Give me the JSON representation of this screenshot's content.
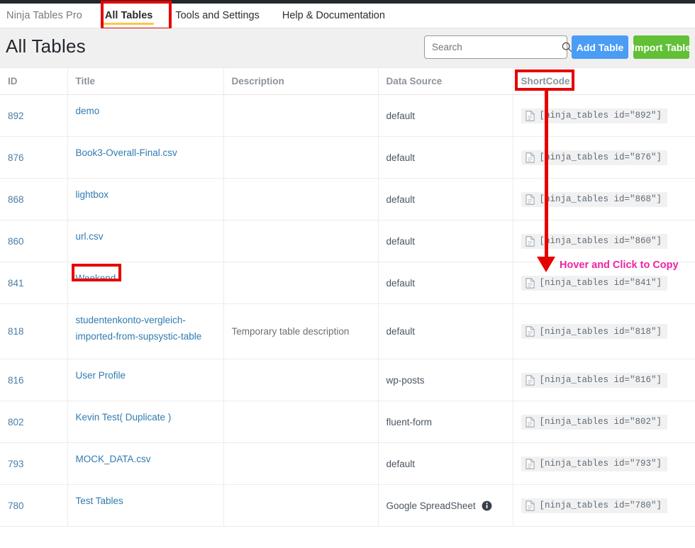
{
  "nav": {
    "brand": "Ninja Tables Pro",
    "tabs": [
      {
        "label": "All Tables",
        "active": true
      },
      {
        "label": "Tools and Settings",
        "active": false
      },
      {
        "label": "Help & Documentation",
        "active": false
      }
    ]
  },
  "header": {
    "title": "All Tables",
    "search_placeholder": "Search",
    "search_value": "",
    "add_table_label": "Add Table",
    "import_table_label": "Import Table"
  },
  "table": {
    "columns": [
      "ID",
      "Title",
      "Description",
      "Data Source",
      "ShortCode"
    ],
    "rows": [
      {
        "id": "892",
        "title": "demo",
        "description": "",
        "source": "default",
        "source_info": false,
        "shortcode": "[ninja_tables id=\"892\"]"
      },
      {
        "id": "876",
        "title": "Book3-Overall-Final.csv",
        "description": "",
        "source": "default",
        "source_info": false,
        "shortcode": "[ninja_tables id=\"876\"]"
      },
      {
        "id": "868",
        "title": "lightbox",
        "description": "",
        "source": "default",
        "source_info": false,
        "shortcode": "[ninja_tables id=\"868\"]"
      },
      {
        "id": "860",
        "title": "url.csv",
        "description": "",
        "source": "default",
        "source_info": false,
        "shortcode": "[ninja_tables id=\"860\"]"
      },
      {
        "id": "841",
        "title": "Weekend",
        "description": "",
        "source": "default",
        "source_info": false,
        "shortcode": "[ninja_tables id=\"841\"]"
      },
      {
        "id": "818",
        "title": "studentenkonto-vergleich-imported-from-supsystic-table",
        "description": "Temporary table description",
        "source": "default",
        "source_info": false,
        "shortcode": "[ninja_tables id=\"818\"]"
      },
      {
        "id": "816",
        "title": "User Profile",
        "description": "",
        "source": "wp-posts",
        "source_info": false,
        "shortcode": "[ninja_tables id=\"816\"]"
      },
      {
        "id": "802",
        "title": "Kevin Test( Duplicate )",
        "description": "",
        "source": "fluent-form",
        "source_info": false,
        "shortcode": "[ninja_tables id=\"802\"]"
      },
      {
        "id": "793",
        "title": "MOCK_DATA.csv",
        "description": "",
        "source": "default",
        "source_info": false,
        "shortcode": "[ninja_tables id=\"793\"]"
      },
      {
        "id": "780",
        "title": "Test Tables",
        "description": "",
        "source": "Google SpreadSheet",
        "source_info": true,
        "shortcode": "[ninja_tables id=\"780\"]"
      }
    ]
  },
  "annotations": {
    "hover_copy_text": "Hover and Click to Copy",
    "highlight_color": "#e60000",
    "callout_color": "#ee22a5"
  },
  "icons": {
    "search": "search-icon",
    "document": "document-icon",
    "info": "info-icon"
  }
}
